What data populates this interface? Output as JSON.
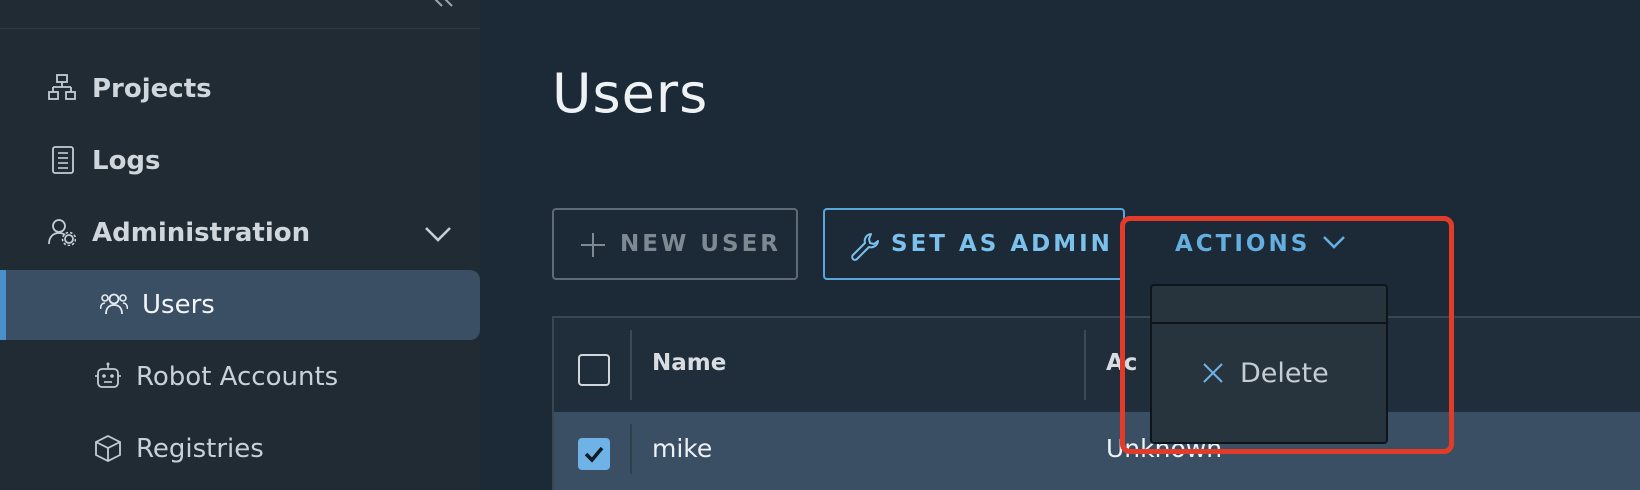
{
  "sidebar": {
    "items": [
      {
        "label": "Projects",
        "icon": "projects-icon"
      },
      {
        "label": "Logs",
        "icon": "logs-icon"
      },
      {
        "label": "Administration",
        "icon": "admin-icon"
      },
      {
        "label": "Users",
        "icon": "users-icon"
      },
      {
        "label": "Robot Accounts",
        "icon": "robot-icon"
      },
      {
        "label": "Registries",
        "icon": "box-icon"
      }
    ]
  },
  "main": {
    "title": "Users",
    "toolbar": {
      "new_user": "NEW USER",
      "set_admin": "SET AS ADMIN",
      "actions": "ACTIONS"
    },
    "table": {
      "headers": [
        "Name",
        "Ac"
      ],
      "rows": [
        {
          "name": "mike",
          "role": "Unknown",
          "checked": true
        }
      ]
    },
    "dropdown": {
      "items": [
        {
          "label": "Delete",
          "icon": "close-icon"
        }
      ]
    }
  },
  "colors": {
    "accent": "#5aa6dc",
    "highlight": "#e23b2a",
    "active_bg": "#3a4f63"
  }
}
